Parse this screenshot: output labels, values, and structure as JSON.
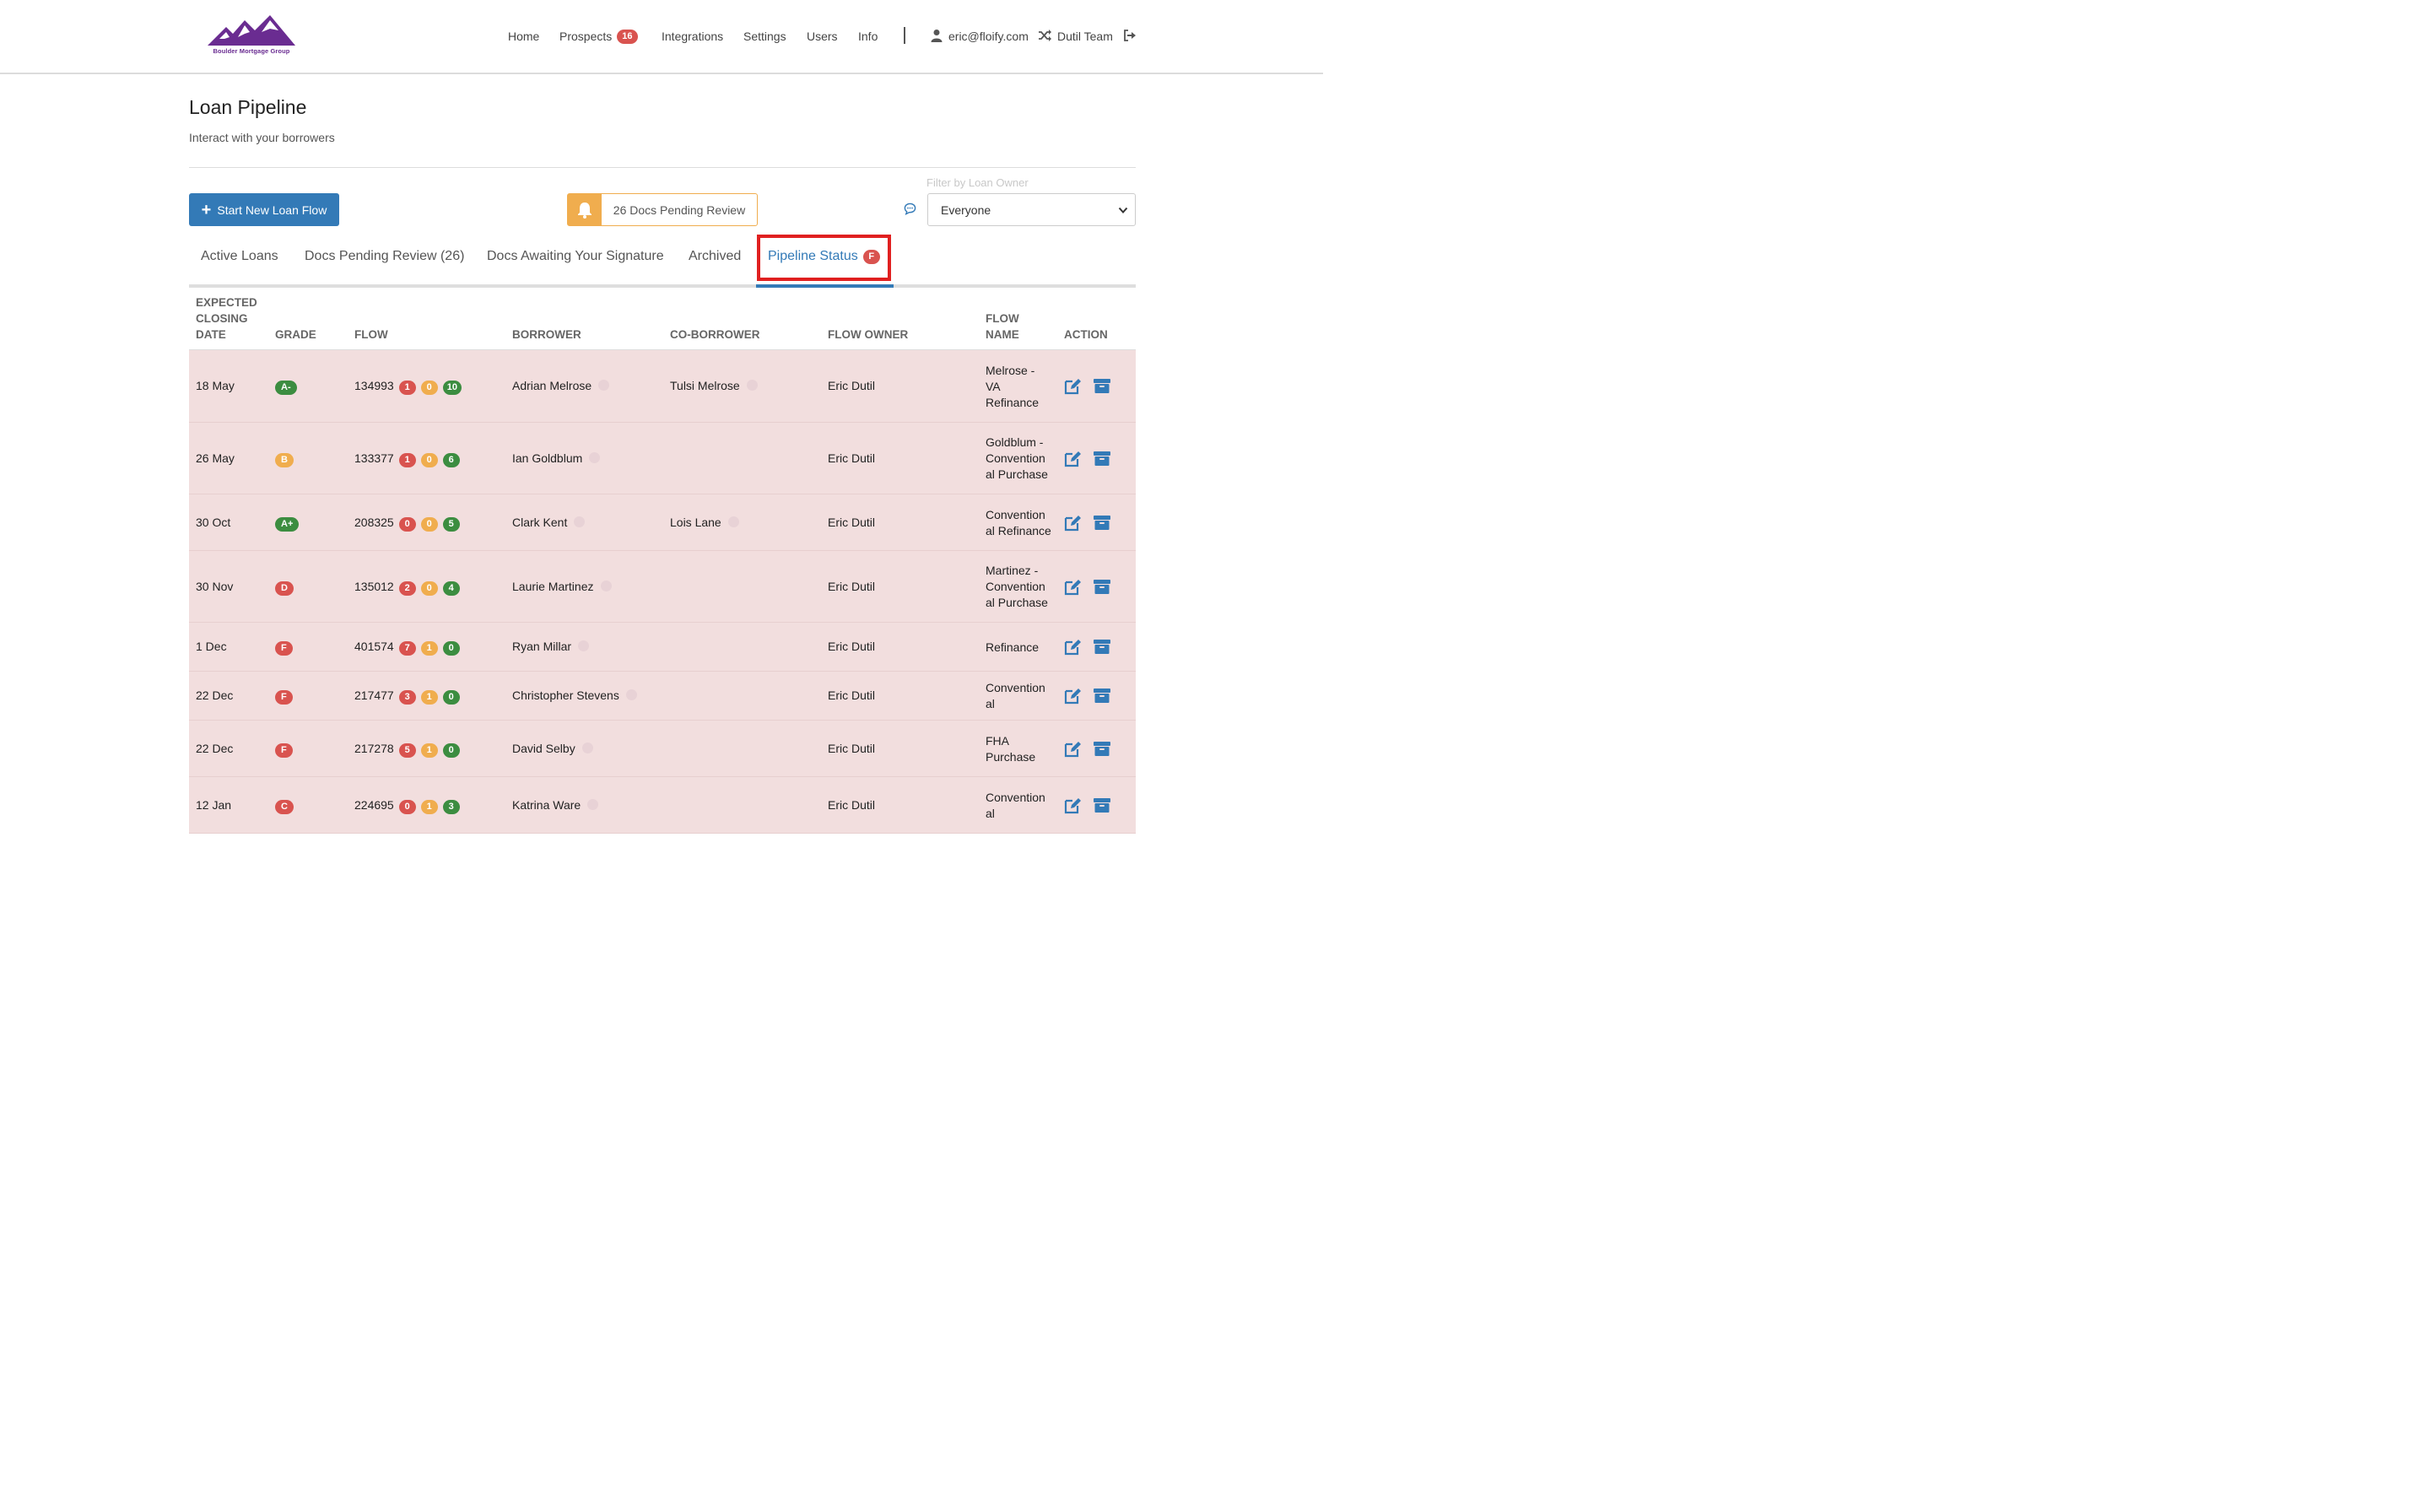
{
  "brand": {
    "logo_text": "Boulder Mortgage Group",
    "color": "#6a2c91"
  },
  "nav": {
    "home": "Home",
    "prospects": "Prospects",
    "prospects_count": "16",
    "integrations": "Integrations",
    "settings": "Settings",
    "users": "Users",
    "info": "Info",
    "user_email": "eric@floify.com",
    "team": "Dutil Team"
  },
  "page": {
    "title": "Loan Pipeline",
    "subtitle": "Interact with your borrowers"
  },
  "toolbar": {
    "new_flow_label": "Start New Loan Flow",
    "pending_label": "26 Docs Pending Review",
    "filter_label": "Filter by Loan Owner",
    "filter_value": "Everyone"
  },
  "tabs": [
    {
      "label": "Active Loans"
    },
    {
      "label": "Docs Pending Review (26)"
    },
    {
      "label": "Docs Awaiting Your Signature"
    },
    {
      "label": "Archived"
    },
    {
      "label": "Pipeline Status",
      "badge": "F",
      "active": true
    }
  ],
  "columns": {
    "closing": [
      "EXPECTED",
      "CLOSING",
      "DATE"
    ],
    "grade": "GRADE",
    "flow": "FLOW",
    "borrower": "BORROWER",
    "coborrower": "CO-BORROWER",
    "owner": "FLOW OWNER",
    "flowname": [
      "FLOW",
      "NAME"
    ],
    "action": "ACTION"
  },
  "colors": {
    "red": "#d9534f",
    "orange": "#f0ad4e",
    "green": "#3c8d40",
    "primary": "#337ab7",
    "row_bg": "#f2dede"
  },
  "rows": [
    {
      "date": "18 May",
      "grade": "A-",
      "grade_color": "green",
      "flow": "134993",
      "b1": "1",
      "b2": "0",
      "b3": "10",
      "borrower": "Adrian Melrose",
      "coborrower": "Tulsi Melrose",
      "owner": "Eric Dutil",
      "flow_name": [
        "Melrose -",
        "VA",
        "Refinance"
      ]
    },
    {
      "date": "26 May",
      "grade": "B",
      "grade_color": "orange",
      "flow": "133377",
      "b1": "1",
      "b2": "0",
      "b3": "6",
      "borrower": "Ian Goldblum",
      "coborrower": "",
      "owner": "Eric Dutil",
      "flow_name": [
        "Goldblum -",
        "Convention",
        "al Purchase"
      ]
    },
    {
      "date": "30 Oct",
      "grade": "A+",
      "grade_color": "green",
      "flow": "208325",
      "b1": "0",
      "b2": "0",
      "b3": "5",
      "borrower": "Clark Kent",
      "coborrower": "Lois Lane",
      "owner": "Eric Dutil",
      "flow_name": [
        "Convention",
        "al Refinance"
      ]
    },
    {
      "date": "30 Nov",
      "grade": "D",
      "grade_color": "red",
      "flow": "135012",
      "b1": "2",
      "b2": "0",
      "b3": "4",
      "borrower": "Laurie Martinez",
      "coborrower": "",
      "owner": "Eric Dutil",
      "flow_name": [
        "Martinez -",
        "Convention",
        "al Purchase"
      ]
    },
    {
      "date": "1 Dec",
      "grade": "F",
      "grade_color": "red",
      "flow": "401574",
      "b1": "7",
      "b2": "1",
      "b3": "0",
      "borrower": "Ryan Millar",
      "coborrower": "",
      "owner": "Eric Dutil",
      "flow_name": [
        "Refinance"
      ]
    },
    {
      "date": "22 Dec",
      "grade": "F",
      "grade_color": "red",
      "flow": "217477",
      "b1": "3",
      "b2": "1",
      "b3": "0",
      "borrower": "Christopher Stevens",
      "coborrower": "",
      "owner": "Eric Dutil",
      "flow_name": [
        "Convention",
        "al"
      ]
    },
    {
      "date": "22 Dec",
      "grade": "F",
      "grade_color": "red",
      "flow": "217278",
      "b1": "5",
      "b2": "1",
      "b3": "0",
      "borrower": "David Selby",
      "coborrower": "",
      "owner": "Eric Dutil",
      "flow_name": [
        "FHA",
        "Purchase"
      ]
    },
    {
      "date": "12 Jan",
      "grade": "C",
      "grade_color": "red",
      "flow": "224695",
      "b1": "0",
      "b2": "1",
      "b3": "3",
      "borrower": "Katrina Ware",
      "coborrower": "",
      "owner": "Eric Dutil",
      "flow_name": [
        "Convention",
        "al"
      ]
    }
  ]
}
